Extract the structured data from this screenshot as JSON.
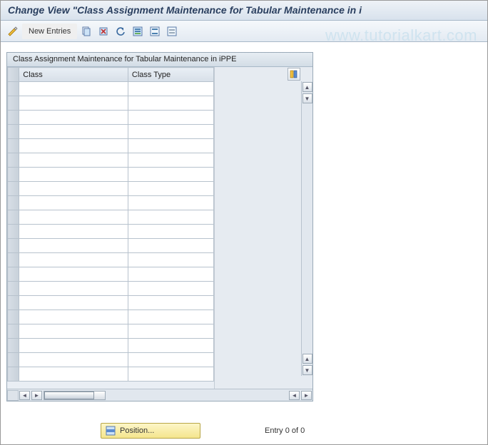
{
  "title": "Change View \"Class Assignment Maintenance for Tabular Maintenance in i",
  "watermark": "www.tutorialkart.com",
  "toolbar": {
    "new_entries_label": "New Entries"
  },
  "panel": {
    "title": "Class Assignment Maintenance for Tabular Maintenance in iPPE",
    "columns": {
      "class": "Class",
      "class_type": "Class Type"
    },
    "rows": [
      {
        "class": "",
        "class_type": ""
      },
      {
        "class": "",
        "class_type": ""
      },
      {
        "class": "",
        "class_type": ""
      },
      {
        "class": "",
        "class_type": ""
      },
      {
        "class": "",
        "class_type": ""
      },
      {
        "class": "",
        "class_type": ""
      },
      {
        "class": "",
        "class_type": ""
      },
      {
        "class": "",
        "class_type": ""
      },
      {
        "class": "",
        "class_type": ""
      },
      {
        "class": "",
        "class_type": ""
      },
      {
        "class": "",
        "class_type": ""
      },
      {
        "class": "",
        "class_type": ""
      },
      {
        "class": "",
        "class_type": ""
      },
      {
        "class": "",
        "class_type": ""
      },
      {
        "class": "",
        "class_type": ""
      },
      {
        "class": "",
        "class_type": ""
      },
      {
        "class": "",
        "class_type": ""
      },
      {
        "class": "",
        "class_type": ""
      },
      {
        "class": "",
        "class_type": ""
      },
      {
        "class": "",
        "class_type": ""
      },
      {
        "class": "",
        "class_type": ""
      }
    ]
  },
  "footer": {
    "position_label": "Position...",
    "entry_text": "Entry 0 of 0"
  },
  "icons": {
    "change": "change-icon",
    "copy": "copy-icon",
    "delete": "delete-icon",
    "undo": "undo-icon",
    "select_all": "select-all-icon",
    "select_block": "select-block-icon",
    "deselect": "deselect-icon",
    "table_settings": "table-settings-icon",
    "grid_position": "grid-position-icon"
  }
}
